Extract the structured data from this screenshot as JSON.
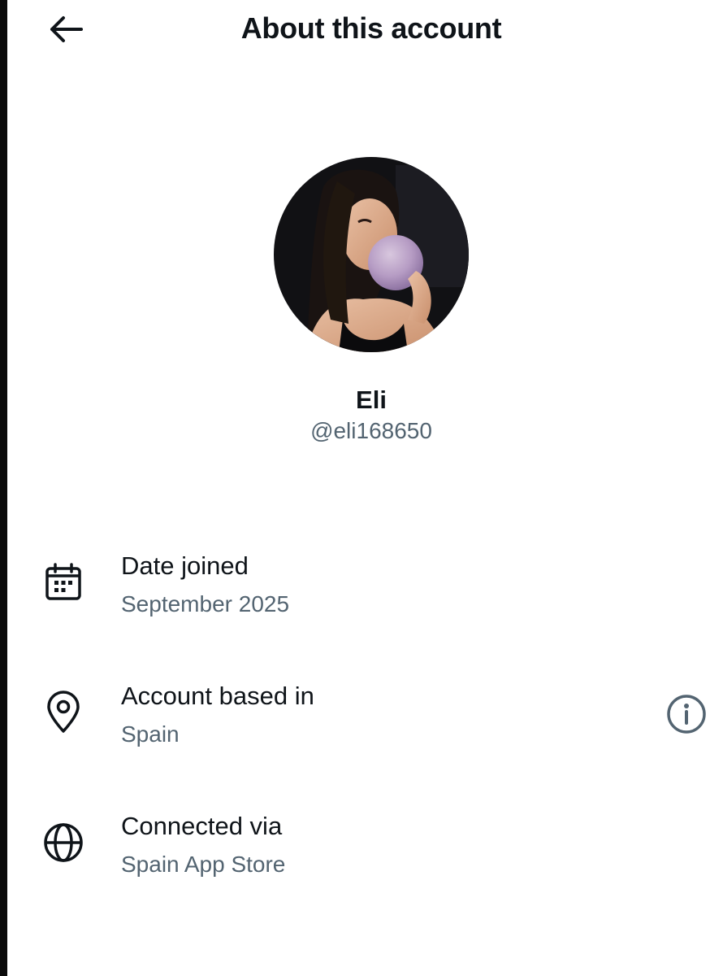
{
  "header": {
    "title": "About this account",
    "back_icon": "arrow-left-icon"
  },
  "profile": {
    "display_name": "Eli",
    "handle": "@eli168650",
    "avatar_description_icon": "avatar-photo"
  },
  "details": [
    {
      "icon": "calendar-icon",
      "title": "Date joined",
      "value": "September 2025"
    },
    {
      "icon": "location-pin-icon",
      "title": "Account based in",
      "value": "Spain",
      "action_icon": "info-icon"
    },
    {
      "icon": "globe-icon",
      "title": "Connected via",
      "value": "Spain App Store"
    }
  ],
  "colors": {
    "text_primary": "#0f1419",
    "text_secondary": "#536471",
    "info_icon": "#536471",
    "background": "#ffffff"
  }
}
